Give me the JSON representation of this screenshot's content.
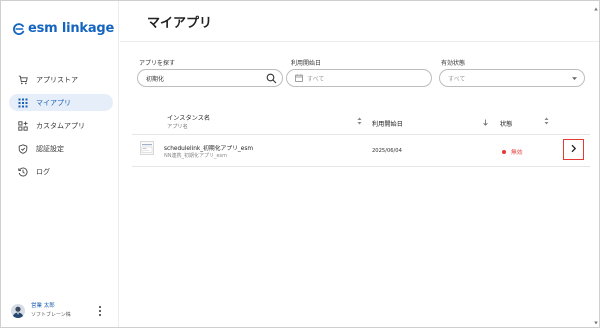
{
  "app": {
    "logo_text": "esm linkage",
    "colors": {
      "brand": "#1565c0",
      "active_bg": "#e6eef9",
      "danger": "#e53935"
    }
  },
  "sidebar": {
    "items": [
      {
        "label": "アプリストア",
        "icon": "cart-icon",
        "active": false
      },
      {
        "label": "マイアプリ",
        "icon": "grid-icon",
        "active": true
      },
      {
        "label": "カスタムアプリ",
        "icon": "custom-app-icon",
        "active": false
      },
      {
        "label": "認証設定",
        "icon": "shield-icon",
        "active": false
      },
      {
        "label": "ログ",
        "icon": "history-icon",
        "active": false
      }
    ],
    "user": {
      "name": "営業 太郎",
      "org": "ソフトブレーン株"
    }
  },
  "main": {
    "title": "マイアプリ",
    "filters": {
      "search": {
        "label": "アプリを探す",
        "value": "初期化"
      },
      "date": {
        "label": "利用開始日",
        "placeholder": "すべて"
      },
      "status": {
        "label": "有効状態",
        "placeholder": "すべて"
      }
    },
    "table": {
      "headers": {
        "name": "インスタンス名",
        "name_sub": "アプリ名",
        "date": "利用開始日",
        "status": "状態"
      },
      "rows": [
        {
          "instance": "schedulelink_初期化アプリ_esm",
          "app": "NN連携_初期化アプリ_esm",
          "date": "2025/06/04",
          "status": "無効"
        }
      ]
    }
  }
}
